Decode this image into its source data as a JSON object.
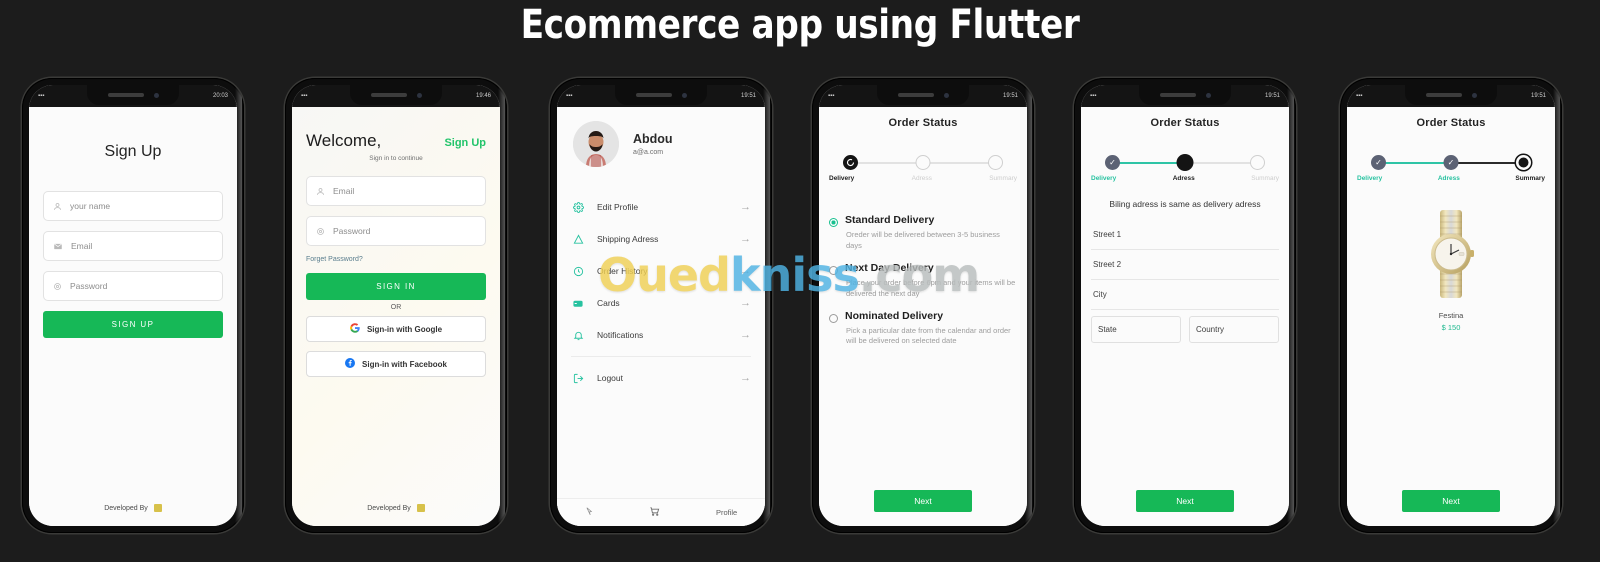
{
  "page": {
    "title": "Ecommerce app using Flutter",
    "background_color": "#1c1c1c",
    "accent_green": "#16b857",
    "accent_teal": "#27c2a0"
  },
  "watermark": {
    "part1": "Oued",
    "part2": "kniss",
    "part3": ".com"
  },
  "statusbar": {
    "signal": "▪▪▪",
    "times": [
      "20:03",
      "19:46",
      "19:51",
      "19:51",
      "19:51",
      "19:51"
    ],
    "battery": "▮"
  },
  "phones": [
    {
      "name": "signup",
      "title": "Sign Up",
      "fields": [
        {
          "icon": "person-icon",
          "placeholder": "your name"
        },
        {
          "icon": "mail-icon",
          "placeholder": "Email"
        },
        {
          "icon": "lock-icon",
          "placeholder": "Password"
        }
      ],
      "primary_button": "SIGN UP",
      "footer": "Developed By"
    },
    {
      "name": "signin",
      "heading": "Welcome,",
      "signup_link": "Sign Up",
      "subtitle": "Sign in to continue",
      "fields": [
        {
          "icon": "person-icon",
          "placeholder": "Email"
        },
        {
          "icon": "lock-icon",
          "placeholder": "Password"
        }
      ],
      "forget_link": "Forget Password?",
      "primary_button": "SIGN IN",
      "divider": "OR",
      "google_button": "Sign-in with Google",
      "facebook_button": "Sign-in with Facebook",
      "footer": "Developed By"
    },
    {
      "name": "profile",
      "user_name": "Abdou",
      "user_email": "a@a.com",
      "menu": [
        {
          "icon": "gear-icon",
          "label": "Edit Profile",
          "arrow": "→"
        },
        {
          "icon": "location-icon",
          "label": "Shipping Adress",
          "arrow": "→"
        },
        {
          "icon": "clock-icon",
          "label": "Order History",
          "arrow": "→"
        },
        {
          "icon": "card-icon",
          "label": "Cards",
          "arrow": "→"
        },
        {
          "icon": "bell-icon",
          "label": "Notifications",
          "arrow": "→"
        },
        {
          "icon": "logout-icon",
          "label": "Logout",
          "arrow": "→"
        }
      ],
      "bottom_nav": [
        {
          "icon": "home-icon",
          "label": ""
        },
        {
          "icon": "cart-icon",
          "label": ""
        },
        {
          "icon": "profile-icon",
          "label": "Profile"
        }
      ]
    },
    {
      "name": "order-status-delivery",
      "title": "Order Status",
      "steps": [
        {
          "label": "Delivery",
          "state": "active"
        },
        {
          "label": "Adress",
          "state": "todo"
        },
        {
          "label": "Summary",
          "state": "todo"
        }
      ],
      "options": [
        {
          "label": "Standard Delivery",
          "description": "Oreder will be delivered between 3-5 business days",
          "selected": true
        },
        {
          "label": "Next Day Delivery",
          "description": "Place your order before 6pm and your items will be delivered the next day",
          "selected": false
        },
        {
          "label": "Nominated Delivery",
          "description": "Pick a particular date from the calendar and order will be delivered on selected date",
          "selected": false
        }
      ],
      "next_button": "Next"
    },
    {
      "name": "order-status-adress",
      "title": "Order Status",
      "steps": [
        {
          "label": "Delivery",
          "state": "done"
        },
        {
          "label": "Adress",
          "state": "active"
        },
        {
          "label": "Summary",
          "state": "todo"
        }
      ],
      "note": "Biling adress is same as delivery adress",
      "fields": [
        "Street 1",
        "Street 2",
        "City"
      ],
      "field_pair": [
        "State",
        "Country"
      ],
      "next_button": "Next"
    },
    {
      "name": "order-status-summary",
      "title": "Order Status",
      "steps": [
        {
          "label": "Delivery",
          "state": "done"
        },
        {
          "label": "Adress",
          "state": "done"
        },
        {
          "label": "Summary",
          "state": "active"
        }
      ],
      "product": {
        "name": "Festina",
        "price": "$ 150",
        "image": "watch-image"
      },
      "next_button": "Next"
    }
  ]
}
